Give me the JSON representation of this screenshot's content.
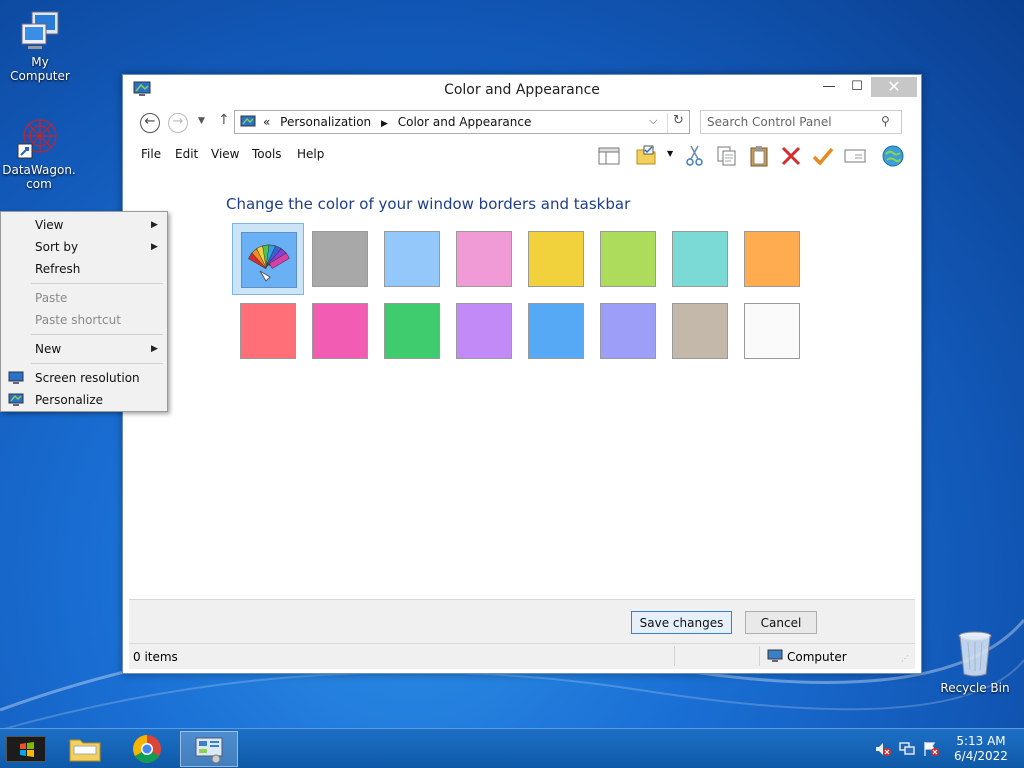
{
  "desktop": {
    "icons": [
      {
        "label": "My Computer"
      },
      {
        "label": "DataWagon.com"
      },
      {
        "label": "Recycle Bin"
      }
    ]
  },
  "window": {
    "title": "Color and Appearance",
    "controls": {
      "minimize": "—",
      "maximize": "☐",
      "close": "✕"
    },
    "breadcrumb": {
      "overflow": "«",
      "items": [
        "Personalization",
        "Color and Appearance"
      ]
    },
    "search_placeholder": "Search Control Panel",
    "menu": [
      "File",
      "Edit",
      "View",
      "Tools",
      "Help"
    ],
    "heading": "Change the color of your window borders and taskbar",
    "swatches": [
      {
        "name": "custom-color",
        "color": "#6ab0f5",
        "selected": true
      },
      {
        "name": "gray",
        "color": "#a8a8a8"
      },
      {
        "name": "sky-blue",
        "color": "#94c8fa"
      },
      {
        "name": "pink",
        "color": "#f09ad6"
      },
      {
        "name": "yellow",
        "color": "#f2d23c"
      },
      {
        "name": "lime",
        "color": "#addb5c"
      },
      {
        "name": "teal",
        "color": "#7bdad6"
      },
      {
        "name": "orange",
        "color": "#ffab4f"
      },
      {
        "name": "red",
        "color": "#ff6f78"
      },
      {
        "name": "magenta",
        "color": "#f25cb3"
      },
      {
        "name": "green",
        "color": "#3fcc6f"
      },
      {
        "name": "purple",
        "color": "#c28af7"
      },
      {
        "name": "blue",
        "color": "#56aaf5"
      },
      {
        "name": "periwinkle",
        "color": "#9d9ef7"
      },
      {
        "name": "taupe",
        "color": "#c4b8ab"
      },
      {
        "name": "white",
        "color": "#fafafa"
      }
    ],
    "buttons": {
      "save": "Save changes",
      "cancel": "Cancel"
    },
    "status": {
      "items": "0 items",
      "location": "Computer"
    }
  },
  "context_menu": {
    "view": "View",
    "sort_by": "Sort by",
    "refresh": "Refresh",
    "paste": "Paste",
    "paste_shortcut": "Paste shortcut",
    "new": "New",
    "screen_resolution": "Screen resolution",
    "personalize": "Personalize"
  },
  "taskbar": {
    "time": "5:13 AM",
    "date": "6/4/2022"
  }
}
